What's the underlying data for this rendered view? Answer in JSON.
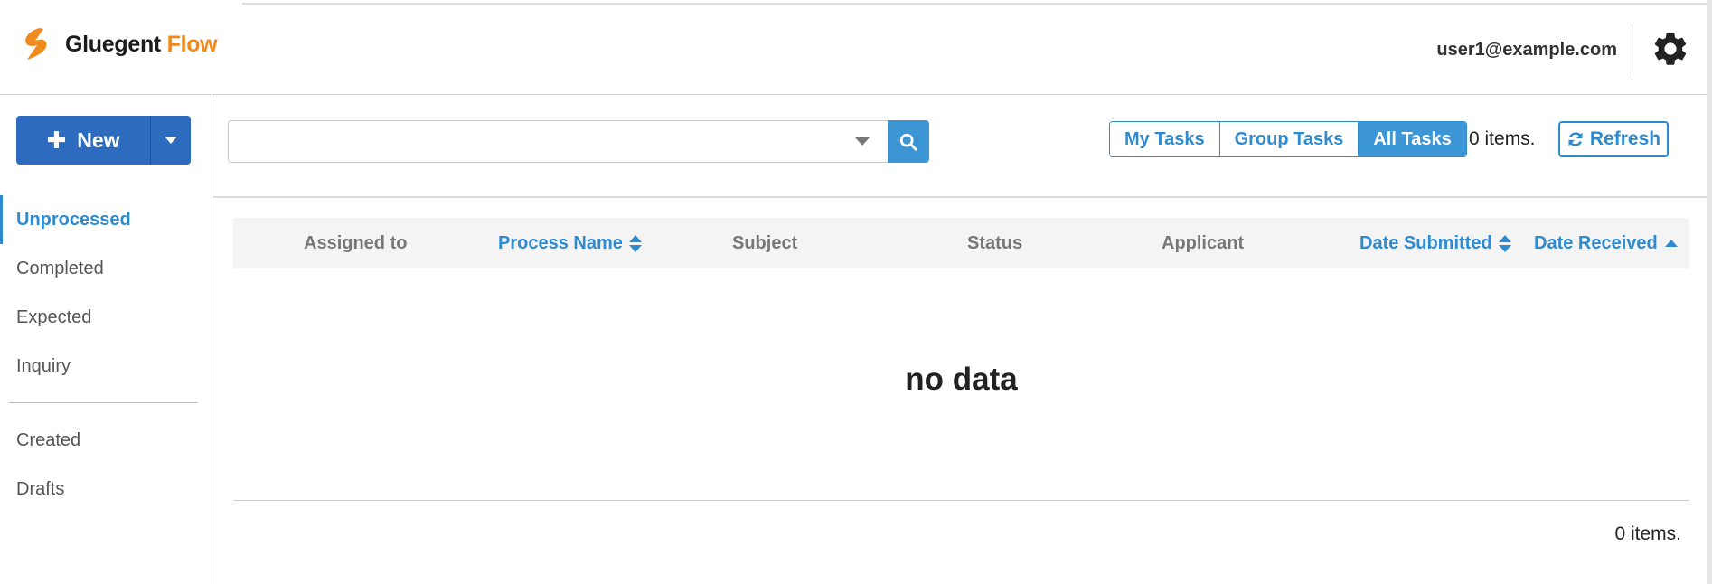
{
  "app": {
    "brand_part1": "Gluegent",
    "brand_part2": "Flow",
    "brand_color": "#f08a1c",
    "accent_color": "#2f8bd0",
    "logo_icon": "lightning-logo-icon"
  },
  "header": {
    "user_email": "user1@example.com",
    "settings_icon": "gear-icon"
  },
  "sidebar": {
    "new_button": {
      "icon": "plus-icon",
      "label": "New",
      "menu_icon": "caret-down-icon"
    },
    "items": [
      {
        "label": "Unprocessed",
        "active": true
      },
      {
        "label": "Completed",
        "active": false
      },
      {
        "label": "Expected",
        "active": false
      },
      {
        "label": "Inquiry",
        "active": false
      }
    ],
    "items_secondary": [
      {
        "label": "Created"
      },
      {
        "label": "Drafts"
      }
    ]
  },
  "toolbar": {
    "search_value": "",
    "search_icon": "search-icon",
    "task_filters": [
      {
        "label": "My Tasks",
        "selected": false
      },
      {
        "label": "Group Tasks",
        "selected": false
      },
      {
        "label": "All Tasks",
        "selected": true
      }
    ],
    "items_count": "0 items.",
    "refresh_label": "Refresh",
    "refresh_icon": "refresh-icon"
  },
  "table": {
    "columns": [
      {
        "label": "Assigned to",
        "sortable": false
      },
      {
        "label": "Process Name",
        "sortable": true,
        "sort": "none"
      },
      {
        "label": "Subject",
        "sortable": false
      },
      {
        "label": "Status",
        "sortable": false
      },
      {
        "label": "Applicant",
        "sortable": false
      },
      {
        "label": "Date Submitted",
        "sortable": true,
        "sort": "none"
      },
      {
        "label": "Date Received",
        "sortable": true,
        "sort": "ascending"
      }
    ],
    "rows": [],
    "empty_message": "no data",
    "footer_count": "0 items."
  }
}
